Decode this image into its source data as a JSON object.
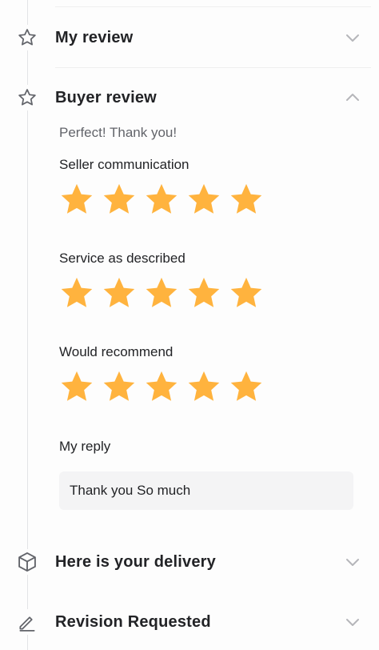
{
  "sections": {
    "my_review": {
      "title": "My review",
      "icon": "star-outline-icon",
      "state": "collapsed"
    },
    "buyer_review": {
      "title": "Buyer review",
      "icon": "star-outline-icon",
      "state": "expanded",
      "text": "Perfect!  Thank you!",
      "ratings": [
        {
          "label": "Seller communication",
          "stars": 5,
          "max": 5
        },
        {
          "label": "Service as described",
          "stars": 5,
          "max": 5
        },
        {
          "label": "Would recommend",
          "stars": 5,
          "max": 5
        }
      ],
      "reply_label": "My reply",
      "reply_text": "Thank you So much"
    },
    "delivery": {
      "title": "Here is your delivery",
      "icon": "package-icon",
      "state": "collapsed"
    },
    "revision": {
      "title": "Revision Requested",
      "icon": "pencil-icon",
      "state": "collapsed"
    }
  },
  "colors": {
    "star": "#FFB33E",
    "text_primary": "#222326",
    "text_secondary": "#62646A",
    "reply_bg": "#F4F4F5",
    "chevron": "#B5B6BA"
  }
}
